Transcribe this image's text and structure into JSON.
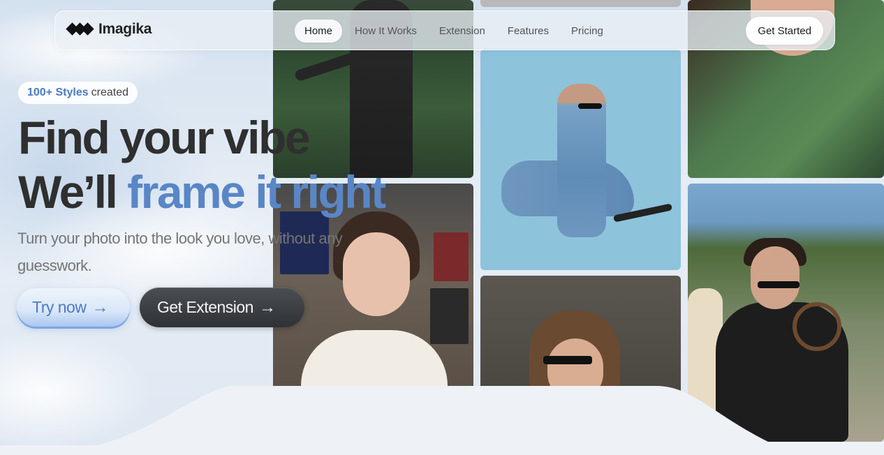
{
  "brand": {
    "name": "Imagika",
    "logo_icon": "diamond-chevrons-icon"
  },
  "nav": {
    "links": [
      {
        "label": "Home",
        "active": true
      },
      {
        "label": "How It Works",
        "active": false
      },
      {
        "label": "Extension",
        "active": false
      },
      {
        "label": "Features",
        "active": false
      },
      {
        "label": "Pricing",
        "active": false
      }
    ],
    "cta_label": "Get Started"
  },
  "hero": {
    "badge_strong": "100+ Styles",
    "badge_rest": "created",
    "headline_line1": "Find your vibe",
    "headline_line2_plain": "We’ll",
    "headline_line2_accent": "frame it right",
    "subtext": "Turn your photo into the look you love, without any guesswork.",
    "primary_button": "Try now",
    "secondary_button": "Get Extension",
    "arrow_icon": "arrow-right-icon"
  },
  "colors": {
    "accent": "#5a86c6",
    "dark_button": "#2e3236",
    "background": "#eef2f7"
  }
}
